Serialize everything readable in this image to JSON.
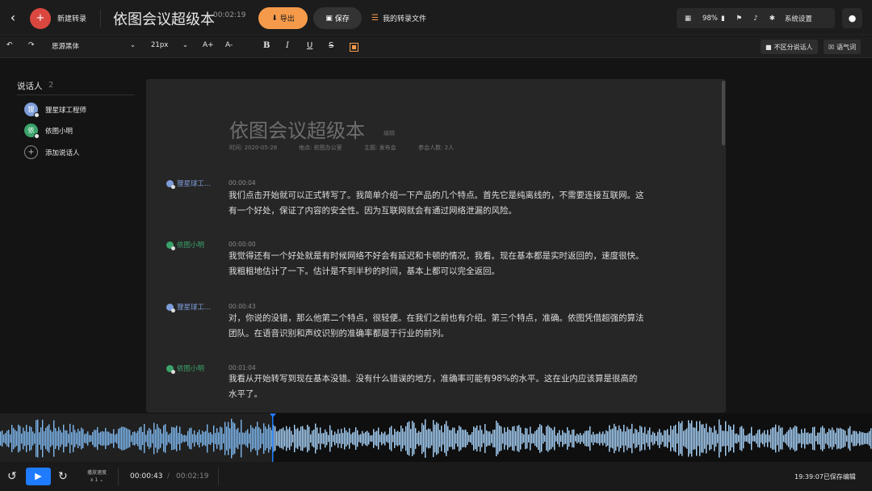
{
  "header": {
    "new_label": "新建转录",
    "title": "依图会议超级本",
    "duration": "00:02:19",
    "export_label": "导出",
    "save_label": "保存",
    "my_files_label": "我的转录文件",
    "battery": "98%",
    "settings_label": "系统设置"
  },
  "toolbar": {
    "font": "思源黑体",
    "size": "21px",
    "increase": "A+",
    "decrease": "A-",
    "bold": "B",
    "italic": "I",
    "underline": "U",
    "strike": "S",
    "no_speaker_label": "不区分说话人",
    "filler_label": "语气词",
    "accent_color": "#f59a4a"
  },
  "sidebar": {
    "title": "说话人",
    "count": "2",
    "speakers": [
      {
        "avatar": "狸",
        "name": "狸星球工程师",
        "color": "#7d9cd8"
      },
      {
        "avatar": "依",
        "name": "依图小明",
        "color": "#3aa36a"
      }
    ],
    "add_label": "添加说话人"
  },
  "document": {
    "title": "依图会议超级本",
    "edit_label": "编辑",
    "meta_time": "时间: 2020-05-28",
    "meta_place": "地点: 依图办公室",
    "meta_topic": "主题: 发布会",
    "meta_people": "参会人数: 2人",
    "paragraphs": [
      {
        "speaker": "狸星球工...",
        "color": "#7d9cd8",
        "time": "00:00:04",
        "text": "我们点击开始就可以正式转写了。我简单介绍一下产品的几个特点。首先它是纯离线的，不需要连接互联网。这有一个好处，保证了内容的安全性。因为互联网就会有通过网络泄漏的风险。"
      },
      {
        "speaker": "依图小明",
        "color": "#3aa36a",
        "time": "00:00:00",
        "text": "我觉得还有一个好处就是有时候网络不好会有延迟和卡顿的情况，我看。现在基本都是实时返回的，速度很快。我粗粗地估计了一下。估计是不到半秒的时间，基本上都可以完全返回。"
      },
      {
        "speaker": "狸星球工...",
        "color": "#7d9cd8",
        "time": "00:00:43",
        "text": "对，你说的没错，那么他第二个特点，很轻便。在我们之前也有介绍。第三个特点，准确。依图凭借超强的算法团队。在语音识别和声纹识别的准确率都居于行业的前列。"
      },
      {
        "speaker": "依图小明",
        "color": "#3aa36a",
        "time": "00:01:04",
        "text": "我看从开始转写到现在基本没错。没有什么错误的地方，准确率可能有98%的水平。这在业内应该算是很高的水平了。"
      }
    ]
  },
  "player": {
    "speed_label": "播放速度",
    "speed_value": "x 1",
    "current_time": "00:00:43",
    "total_time": "00:02:19",
    "saved_status": "19:39:07已保存编辑",
    "progress": 0.309
  }
}
